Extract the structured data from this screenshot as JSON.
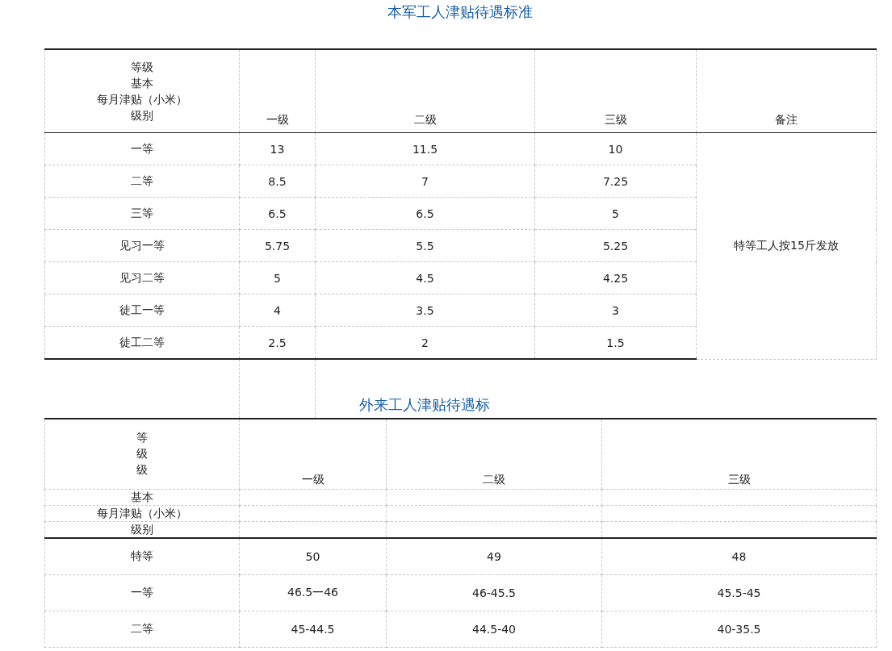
{
  "title": "本军工人津贴待遇标准",
  "table1": {
    "header_label": [
      "等级",
      "基本",
      "每月津贴（小米）",
      "级别"
    ],
    "columns": [
      "一级",
      "二级",
      "三级",
      "备注"
    ],
    "rows": [
      {
        "grade": "一等",
        "values": [
          "13",
          "11.5",
          "10"
        ]
      },
      {
        "grade": "二等",
        "values": [
          "8.5",
          "7",
          "7.25"
        ]
      },
      {
        "grade": "三等",
        "values": [
          "6.5",
          "6.5",
          "5"
        ]
      },
      {
        "grade": "见习一等",
        "values": [
          "5.75",
          "5.5",
          "5.25"
        ]
      },
      {
        "grade": "见习二等",
        "values": [
          "5",
          "4.5",
          "4.25"
        ]
      },
      {
        "grade": "徒工一等",
        "values": [
          "4",
          "3.5",
          "3"
        ]
      },
      {
        "grade": "徒工二等",
        "values": [
          "2.5",
          "2",
          "1.5"
        ]
      }
    ],
    "remark": "特等工人按15斤发放"
  },
  "title2": "外来工人津贴待遇标",
  "table2": {
    "header_label": [
      "等",
      "级",
      "级"
    ],
    "header_label_lower": [
      "基本",
      "每月津贴（小米）",
      "级别"
    ],
    "columns": [
      "一级",
      "二级",
      "三级"
    ],
    "rows": [
      {
        "grade": "特等",
        "values": [
          "50",
          "49",
          "48"
        ]
      },
      {
        "grade": "一等",
        "values": [
          "46.5一46",
          "46-45.5",
          "45.5-45"
        ]
      },
      {
        "grade": "二等",
        "values": [
          "45-44.5",
          "44.5-40",
          "40-35.5"
        ]
      }
    ]
  }
}
